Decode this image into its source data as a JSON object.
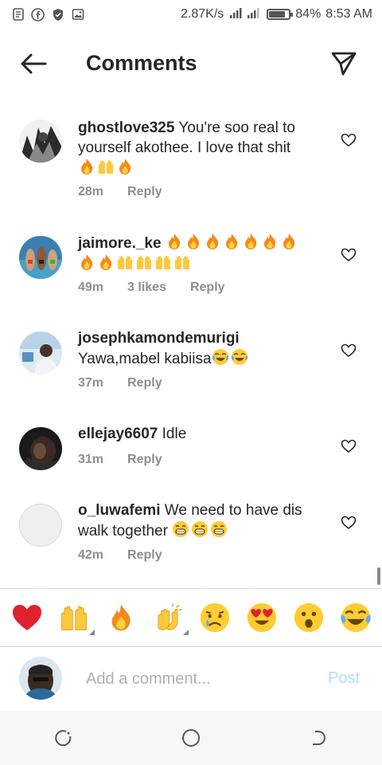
{
  "status_bar": {
    "speed": "2.87K/s",
    "battery": "84%",
    "battery_level": 0.84,
    "time": "8:53 AM",
    "icons": [
      "notes-icon",
      "facebook-icon",
      "shield-icon",
      "image-icon"
    ]
  },
  "header": {
    "title": "Comments",
    "back_icon": "back-arrow-icon",
    "send_icon": "direct-send-icon"
  },
  "comments": [
    {
      "username": "ghostlove325",
      "text": "You're soo real to yourself akothee. I love that shit",
      "emojis": [
        "fire",
        "raised-hands",
        "fire"
      ],
      "time": "28m",
      "likes": "",
      "reply": "Reply"
    },
    {
      "username": "jaimore._ke",
      "text": "",
      "emojis": [
        "fire",
        "fire",
        "fire",
        "fire",
        "fire",
        "fire",
        "fire",
        "fire",
        "fire",
        "raised-hands",
        "raised-hands",
        "raised-hands",
        "raised-hands"
      ],
      "time": "49m",
      "likes": "3 likes",
      "reply": "Reply"
    },
    {
      "username": "josephkamondemurigi",
      "text": "Yawa,mabel kabiisa",
      "emojis": [
        "joy",
        "joy"
      ],
      "time": "37m",
      "likes": "",
      "reply": "Reply"
    },
    {
      "username": "ellejay6607",
      "text": "Idle",
      "emojis": [],
      "time": "31m",
      "likes": "",
      "reply": "Reply"
    },
    {
      "username": "o_luwafemi",
      "text": "We need to have dis walk together",
      "emojis": [
        "grin",
        "grin",
        "grin"
      ],
      "time": "42m",
      "likes": "",
      "reply": "Reply"
    }
  ],
  "emoji_bar": [
    "red-heart",
    "raised-hands",
    "fire",
    "clapping-hands",
    "crying-face",
    "heart-eyes-face",
    "surprised-face",
    "joy-face"
  ],
  "add_comment": {
    "placeholder": "Add a comment...",
    "post_label": "Post"
  },
  "nav_bar": [
    "recent-apps-icon",
    "home-icon",
    "back-icon"
  ],
  "colors": {
    "text": "#262626",
    "secondary": "#8e8e8e",
    "post_disabled": "#b3dbff",
    "heart_red": "#e0212e"
  }
}
